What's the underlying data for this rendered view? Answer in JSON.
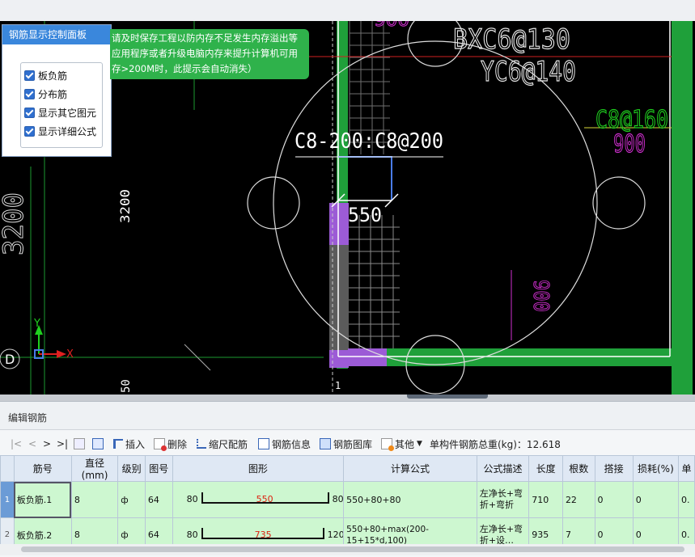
{
  "panel": {
    "title": "钢筋显示控制面板",
    "options": [
      {
        "label": "板负筋",
        "checked": true
      },
      {
        "label": "分布筋",
        "checked": true
      },
      {
        "label": "显示其它图元",
        "checked": true
      },
      {
        "label": "显示详细公式",
        "checked": true
      }
    ]
  },
  "tip": {
    "line1": "请及时保存工程以防内存不足发生内存溢出等",
    "line2": "应用程序或者升级电脑内存来提升计算机可用",
    "line3": "存>200M时，此提示会自动消失）"
  },
  "cad": {
    "label_top_right_1": "BXC6@130",
    "label_top_right_2": "YC6@140",
    "label_c8_160": "C8@160",
    "label_900_a": "900",
    "label_c8_200": "C8-200:C8@200",
    "label_550": "550",
    "label_900_b": "900",
    "label_3200_small": "3200",
    "label_3200_big": "3200",
    "label_axis_d": "D",
    "label_x": "X",
    "label_y": "Y",
    "label_top_pink": "900",
    "label_1": "1",
    "label_50": "50"
  },
  "editor": {
    "title": "编辑钢筋",
    "nav": [
      "|<",
      "<",
      ">",
      ">|"
    ],
    "toolbar": {
      "insert": "插入",
      "delete": "删除",
      "scale": "缩尺配筋",
      "info": "钢筋信息",
      "library": "钢筋图库",
      "other": "其他",
      "total_label": "单构件钢筋总重(kg)：12.618"
    },
    "columns": [
      "筋号",
      "直径(mm)",
      "级别",
      "图号",
      "图形",
      "计算公式",
      "公式描述",
      "长度",
      "根数",
      "搭接",
      "损耗(%)",
      "单"
    ],
    "rows": [
      {
        "index": "1",
        "name": "板负筋.1",
        "diameter": "8",
        "grade": "ф",
        "fig_no": "64",
        "shape_left": "80",
        "shape_mid": "550",
        "shape_right": "80",
        "formula": "550+80+80",
        "desc": "左净长+弯折+弯折",
        "length": "710",
        "count": "22",
        "lap": "0",
        "loss": "0",
        "unit": "0."
      },
      {
        "index": "2",
        "name": "板负筋.2",
        "diameter": "8",
        "grade": "ф",
        "fig_no": "64",
        "shape_left": "80",
        "shape_mid": "735",
        "shape_right": "120",
        "formula": "550+80+max(200-15+15*d,100)",
        "desc": "左净长+弯折+设…",
        "length": "935",
        "count": "7",
        "lap": "0",
        "loss": "0",
        "unit": "0."
      }
    ]
  },
  "colors": {
    "accent": "#3a87dc",
    "tip_bg": "#2fb24b",
    "cad_green": "#1fa03a",
    "cad_magenta": "#d02fd0",
    "row_bg": "#cdf7d0"
  }
}
